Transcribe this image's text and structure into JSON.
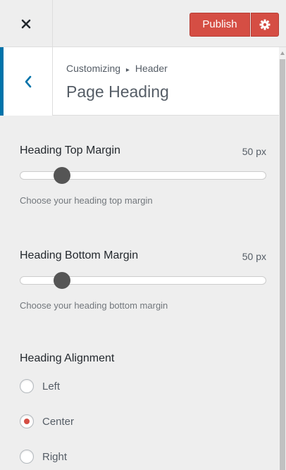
{
  "header": {
    "publish_label": "Publish",
    "close_icon": "close-icon",
    "settings_icon": "gear-icon"
  },
  "section": {
    "breadcrumb_root": "Customizing",
    "breadcrumb_sep": "▸",
    "breadcrumb_parent": "Header",
    "title": "Page Heading"
  },
  "controls": {
    "top_margin": {
      "title": "Heading Top Margin",
      "value": "50 px",
      "description": "Choose your heading top margin",
      "slider_fraction": 0.17
    },
    "bottom_margin": {
      "title": "Heading Bottom Margin",
      "value": "50 px",
      "description": "Choose your heading bottom margin",
      "slider_fraction": 0.17
    },
    "alignment": {
      "title": "Heading Alignment",
      "options": [
        "Left",
        "Center",
        "Right"
      ],
      "selected": "Center"
    }
  },
  "colors": {
    "accent_publish": "#d54e44",
    "back_bar": "#0073aa",
    "panel_bg": "#eeeeee"
  }
}
